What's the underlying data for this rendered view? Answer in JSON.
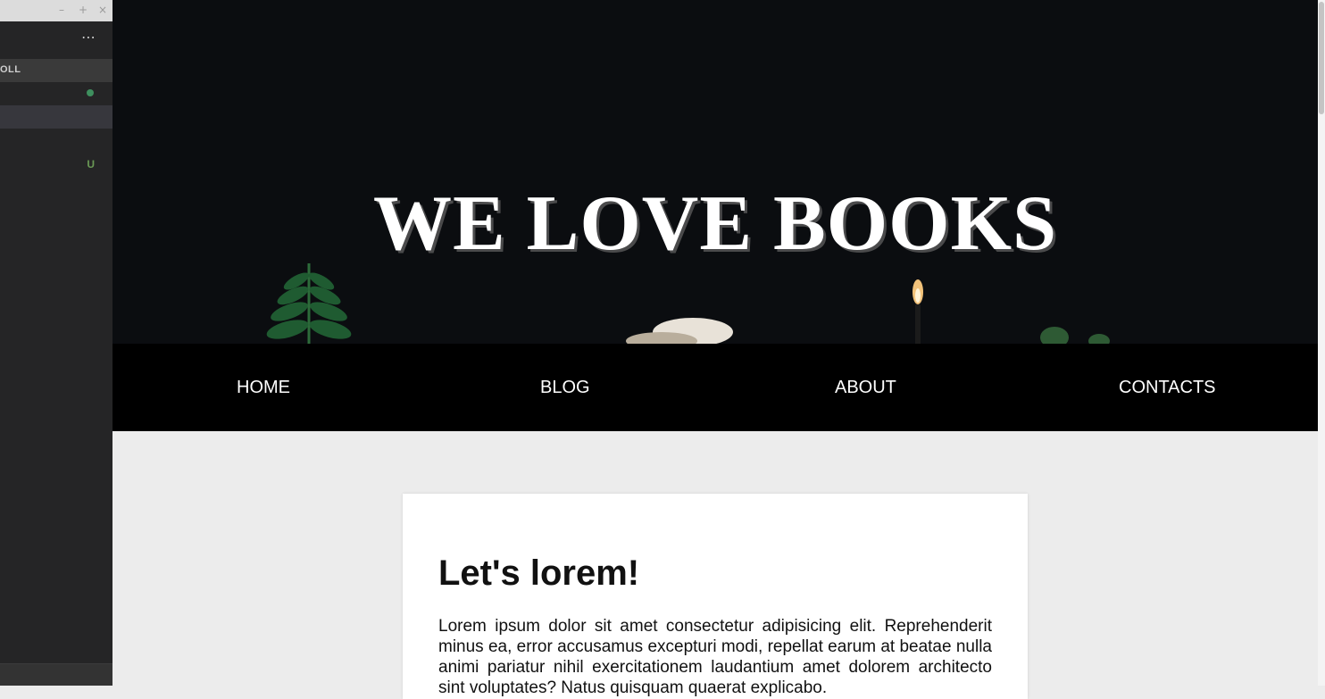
{
  "editor": {
    "window_controls": [
      "–",
      "+",
      "×"
    ],
    "more_icon": "ellipsis-icon",
    "section_label": "OLL",
    "status_letter": "U",
    "colors": {
      "panel": "#252526",
      "selected_row": "#37373d",
      "git_green": "#3e8f5e"
    }
  },
  "hero": {
    "title": "WE LOVE BOOKS",
    "background_color": "#0b0d10"
  },
  "nav": {
    "items": [
      {
        "label": "HOME"
      },
      {
        "label": "BLOG"
      },
      {
        "label": "ABOUT"
      },
      {
        "label": "CONTACTS"
      }
    ]
  },
  "article": {
    "heading": "Let's lorem!",
    "body": "Lorem ipsum dolor sit amet consectetur adipisicing elit. Reprehenderit minus ea, error accusamus excepturi modi, repellat earum at beatae nulla animi pariatur nihil exercitationem laudantium amet dolorem architecto sint voluptates? Natus quisquam quaerat explicabo."
  }
}
